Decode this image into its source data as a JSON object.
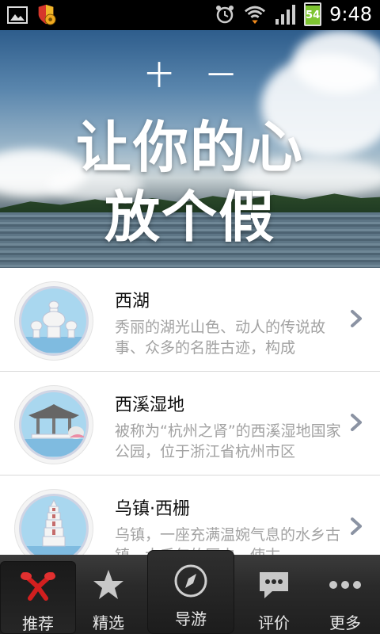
{
  "status_bar": {
    "battery": "54",
    "time": "9:48"
  },
  "banner": {
    "subtitle": "十一",
    "title_line1": "让你的心",
    "title_line2": "放个假"
  },
  "list": [
    {
      "title": "西湖",
      "desc": "秀丽的湖光山色、动人的传说故事、众多的名胜古迹，构成"
    },
    {
      "title": "西溪湿地",
      "desc": "被称为“杭州之肾”的西溪湿地国家公园，位于浙江省杭州市区"
    },
    {
      "title": "乌镇·西栅",
      "desc": "乌镇，一座充满温婉气息的水乡古镇，大千年的历史，使古"
    }
  ],
  "tabs": [
    {
      "label": "推荐",
      "icon": "ribbon-icon"
    },
    {
      "label": "精选",
      "icon": "star-icon"
    },
    {
      "label": "导游",
      "icon": "compass-icon"
    },
    {
      "label": "评价",
      "icon": "speech-bubble-icon"
    },
    {
      "label": "更多",
      "icon": "more-dots-icon"
    }
  ],
  "colors": {
    "active_tab_icon": "#d21f1f",
    "desc_text": "#a2a2a2",
    "battery_green": "#7ec532"
  }
}
